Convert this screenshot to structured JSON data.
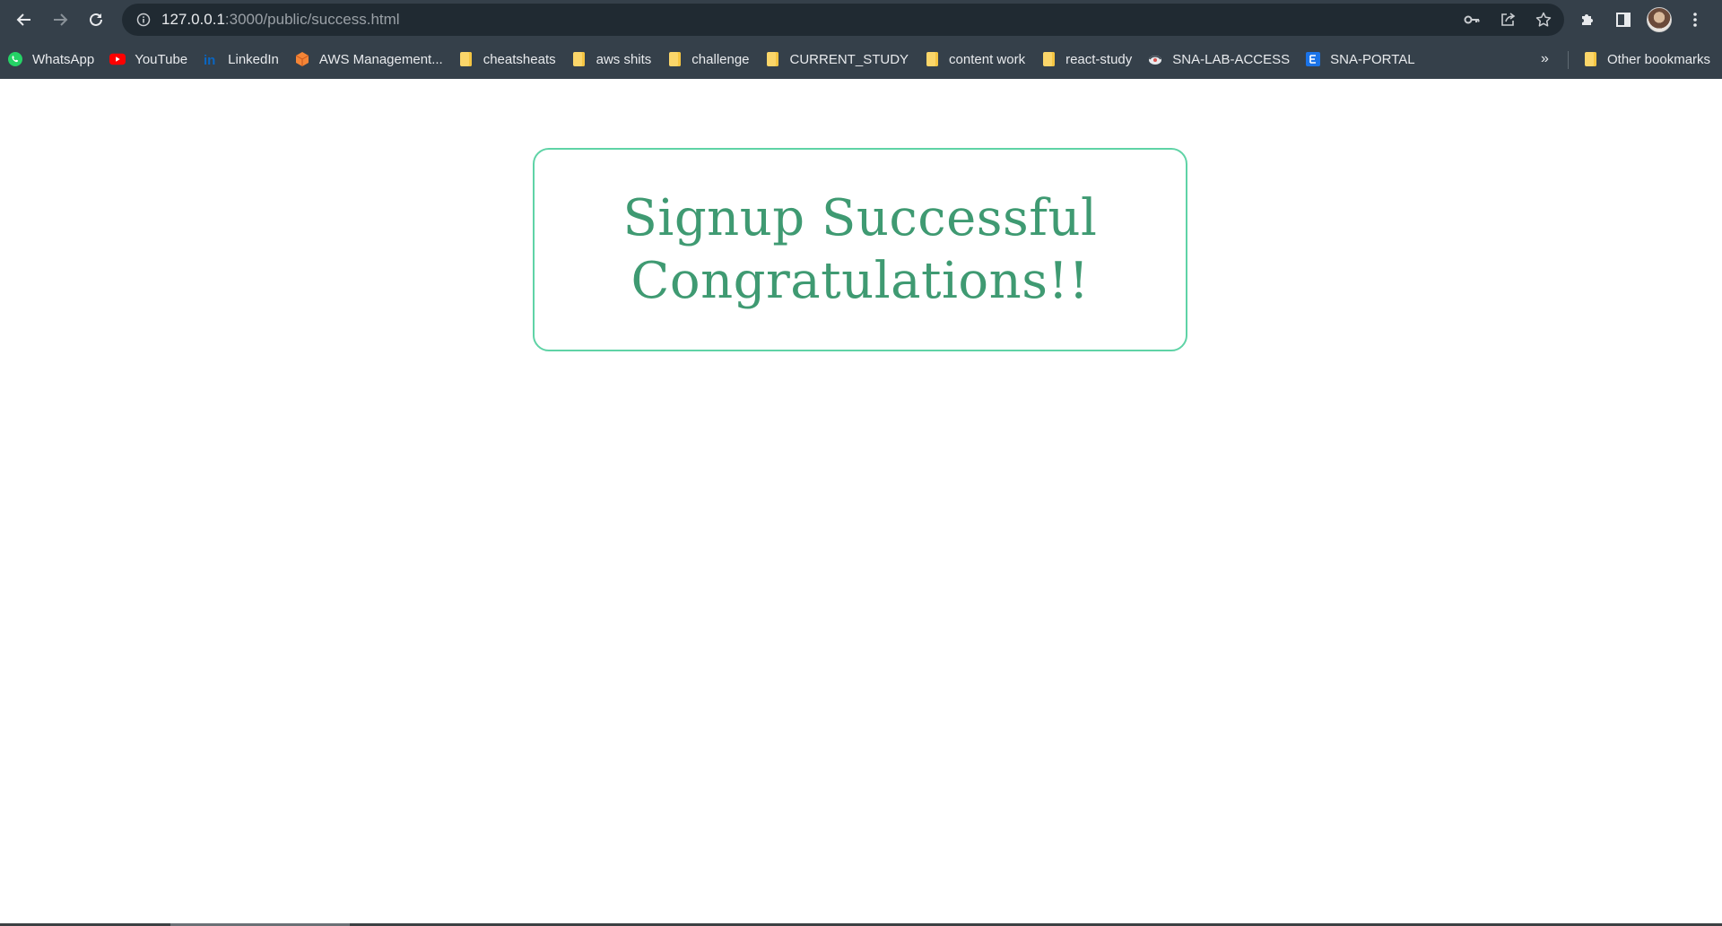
{
  "browser": {
    "url_host": "127.0.0.1",
    "url_rest": ":3000/public/success.html",
    "toolbar_icons": [
      "back-icon",
      "forward-icon",
      "reload-icon",
      "site-info-icon",
      "key-icon",
      "share-icon",
      "star-icon",
      "extensions-icon",
      "side-panel-icon",
      "avatar",
      "menu-icon"
    ]
  },
  "bookmarks": {
    "items": [
      {
        "label": "WhatsApp",
        "icon": "whatsapp-icon"
      },
      {
        "label": "YouTube",
        "icon": "youtube-icon"
      },
      {
        "label": "LinkedIn",
        "icon": "linkedin-icon"
      },
      {
        "label": "AWS Management...",
        "icon": "aws-icon"
      },
      {
        "label": "cheatsheats",
        "icon": "folder-icon"
      },
      {
        "label": "aws shits",
        "icon": "folder-icon"
      },
      {
        "label": "challenge",
        "icon": "folder-icon"
      },
      {
        "label": "CURRENT_STUDY",
        "icon": "folder-icon"
      },
      {
        "label": "content work",
        "icon": "folder-icon"
      },
      {
        "label": "react-study",
        "icon": "folder-icon"
      },
      {
        "label": "SNA-LAB-ACCESS",
        "icon": "globe-icon"
      },
      {
        "label": "SNA-PORTAL",
        "icon": "portal-icon"
      }
    ],
    "overflow": "»",
    "other": "Other bookmarks"
  },
  "page": {
    "line1": "Signup Successful",
    "line2": "Congratulations!!"
  },
  "colors": {
    "chrome_bg": "#35404a",
    "omnibox_bg": "#202a32",
    "card_border": "#5fd3a6",
    "text_green": "#3f9a72"
  }
}
